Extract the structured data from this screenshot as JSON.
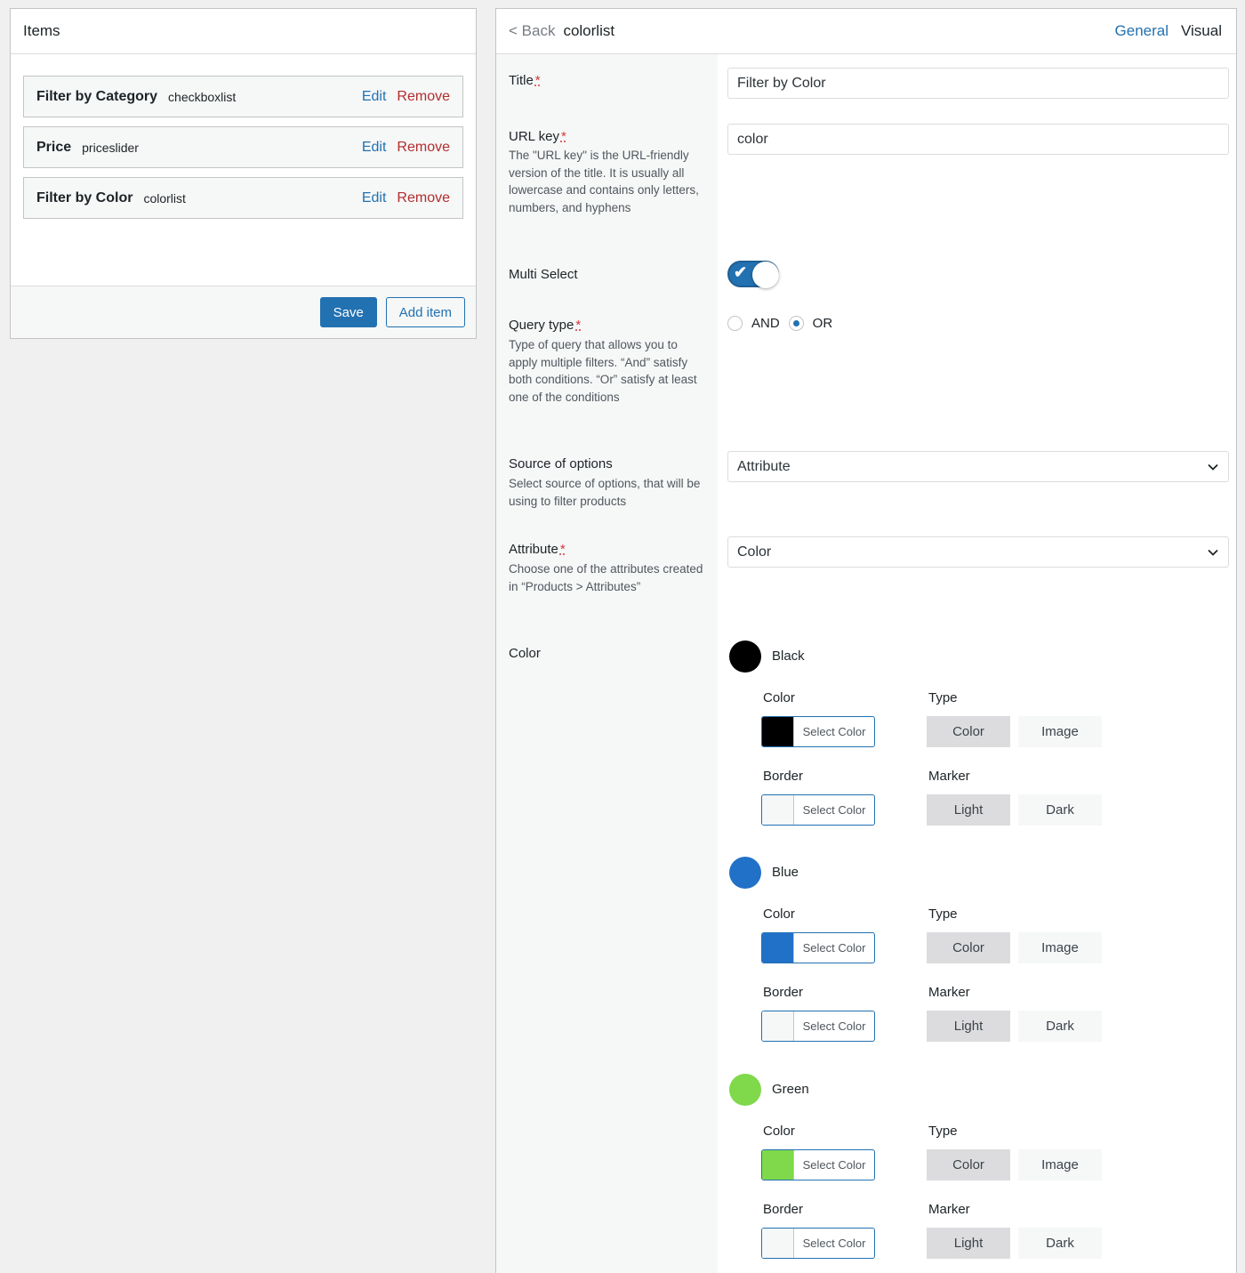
{
  "items_panel": {
    "title": "Items",
    "items": [
      {
        "title": "Filter by Category",
        "type": "checkboxlist",
        "edit": "Edit",
        "remove": "Remove"
      },
      {
        "title": "Price",
        "type": "priceslider",
        "edit": "Edit",
        "remove": "Remove"
      },
      {
        "title": "Filter by Color",
        "type": "colorlist",
        "edit": "Edit",
        "remove": "Remove"
      }
    ],
    "save_label": "Save",
    "add_item_label": "Add item"
  },
  "editor": {
    "back_label": "< Back",
    "title": "colorlist",
    "tabs": [
      {
        "label": "General",
        "active": true
      },
      {
        "label": "Visual",
        "active": false
      }
    ],
    "required_mark": "*",
    "fields": {
      "title": {
        "label": "Title",
        "value": "Filter by Color"
      },
      "url_key": {
        "label": "URL key",
        "value": "color",
        "description": "The \"URL key\" is the URL-friendly version of the title. It is usually all lowercase and contains only letters, numbers, and hyphens"
      },
      "multi_select": {
        "label": "Multi Select",
        "enabled": true,
        "check_glyph": "✔"
      },
      "query_type": {
        "label": "Query type",
        "description": "Type of query that allows you to apply multiple filters. “And” satisfy both conditions. “Or” satisfy at least one of the conditions",
        "options": [
          "AND",
          "OR"
        ],
        "selected": "OR"
      },
      "source": {
        "label": "Source of options",
        "description": "Select source of options, that will be using to filter products",
        "value": "Attribute"
      },
      "attribute": {
        "label": "Attribute",
        "description": "Choose one of the attributes created in “Products > Attributes”",
        "value": "Color"
      },
      "color": {
        "label": "Color"
      }
    },
    "color_labels": {
      "color": "Color",
      "type": "Type",
      "border": "Border",
      "marker": "Marker",
      "select_color": "Select Color",
      "type_options": [
        "Color",
        "Image"
      ],
      "marker_options": [
        "Light",
        "Dark"
      ]
    },
    "colors": [
      {
        "name": "Black",
        "swatch": "#000000",
        "color_value": "#000000",
        "border_value": "#f6f7f7",
        "type": "Color",
        "marker": "Light"
      },
      {
        "name": "Blue",
        "swatch": "#2271c8",
        "color_value": "#2271c8",
        "border_value": "#f6f7f7",
        "type": "Color",
        "marker": "Light"
      },
      {
        "name": "Green",
        "swatch": "#7fd94a",
        "color_value": "#7fd94a",
        "border_value": "#f6f7f7",
        "type": "Color",
        "marker": "Light"
      }
    ]
  }
}
